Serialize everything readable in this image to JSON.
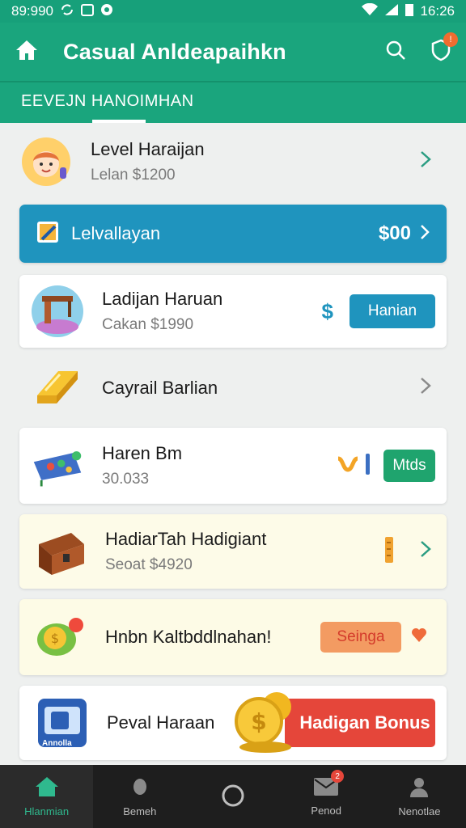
{
  "status": {
    "time_left": "89:990",
    "time_right": "16:26"
  },
  "appbar": {
    "title": "Casual Anldeapaihkn"
  },
  "tab": {
    "label": "EEVEJN HANOIMHAN"
  },
  "items": [
    {
      "title": "Level Haraijan",
      "subtitle": "Lelan $1200"
    },
    {
      "title": "Lelvallayan",
      "amount": "$00"
    },
    {
      "title": "Ladijan Haruan",
      "subtitle": "Cakan $1990",
      "currency": "$",
      "button": "Hanian"
    },
    {
      "title": "Cayrail Barlian"
    },
    {
      "title": "Haren Bm",
      "subtitle": "30.033",
      "button": "Mtds"
    },
    {
      "title": "HadiarTah Hadigiant",
      "subtitle": "Seoat $4920"
    },
    {
      "title": "Hnbn Kaltbddlnahan!",
      "button": "Seinga"
    },
    {
      "title": "Peval Haraan",
      "icon_label": "Annolla",
      "button": "Hadigan Bonus"
    }
  ],
  "nav": [
    {
      "label": "Hlanmian"
    },
    {
      "label": "Bemeh"
    },
    {
      "label": ""
    },
    {
      "label": "Penod",
      "badge": "2"
    },
    {
      "label": "Nenotlae"
    }
  ],
  "colors": {
    "primary": "#1aa57d",
    "blue": "#1f94be",
    "orange": "#f3a066",
    "red": "#e5463a"
  }
}
